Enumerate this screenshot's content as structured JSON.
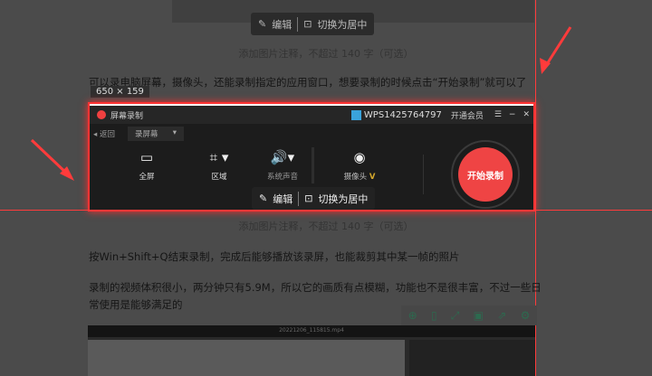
{
  "top_toolbar": {
    "edit": "编辑",
    "center": "切换为居中"
  },
  "caption1": "添加图片注释，不超过 140 字（可选）",
  "para1": "可以录电脑屏幕，摄像头，还能录制指定的应用窗口，想要录制的时候点击“开始录制”就可以了",
  "selection_size": "650 × 159",
  "recorder": {
    "title": "屏幕录制",
    "user": "WPS1425764797",
    "vip": "开通会员",
    "back": "返回",
    "mode": "录屏幕",
    "tools": [
      {
        "label": "全屏",
        "icon": "monitor"
      },
      {
        "label": "区域",
        "icon": "crop"
      },
      {
        "label": "系统声音",
        "icon": "speaker"
      },
      {
        "label": "摄像头",
        "icon": "camera"
      }
    ],
    "vip_badge": "V",
    "start": "开始录制"
  },
  "overlay_toolbar": {
    "edit": "编辑",
    "center": "切换为居中"
  },
  "caption2": "添加图片注释，不超过 140 字（可选）",
  "para2": "按Win+Shift+Q结束录制，完成后能够播放该录屏，也能裁剪其中某一帧的照片",
  "para3_l1": "录制的视频体积很小，两分钟只有5.9M，所以它的画质有点模糊，功能也不是很丰富，不过一些日",
  "para3_l2": "常使用是能够满足的",
  "video_title": "20221206_115815.mp4",
  "accent": "#ef4444"
}
